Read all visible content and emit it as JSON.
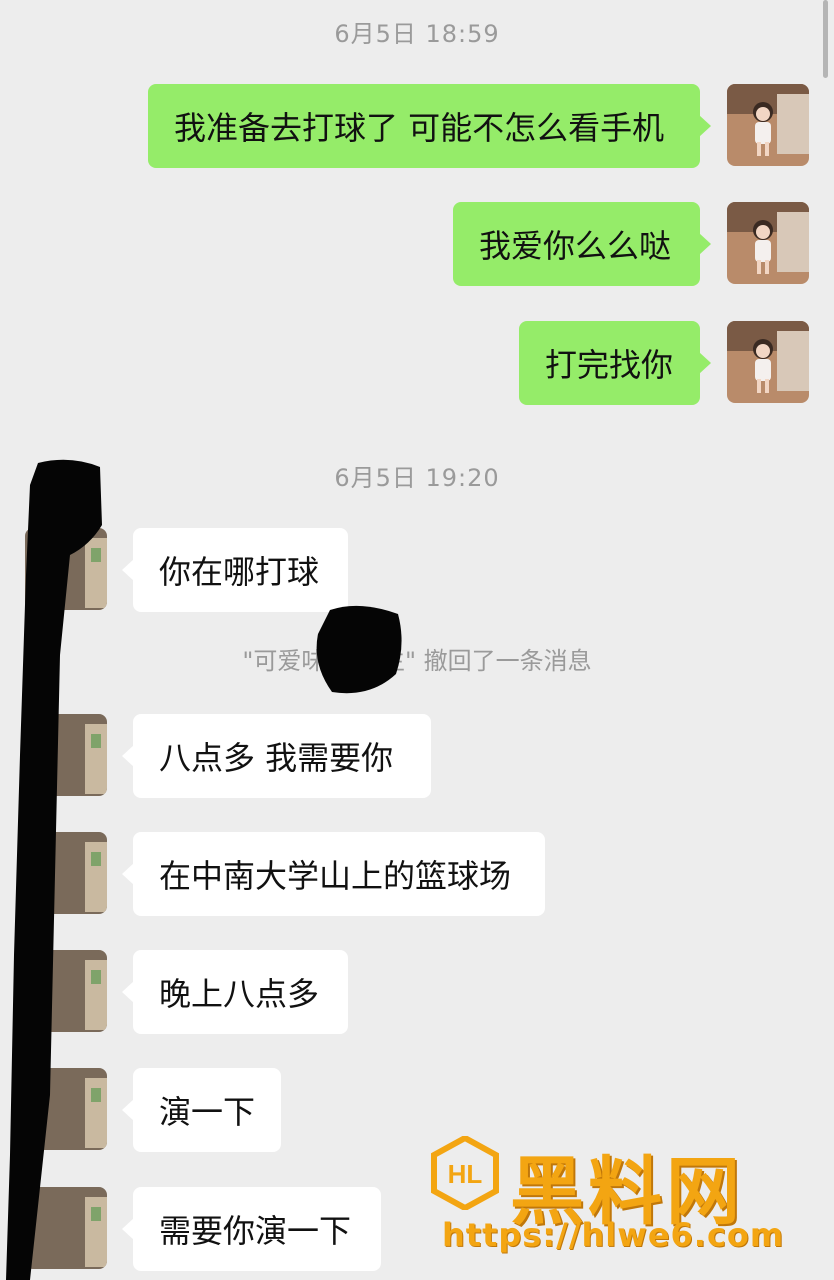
{
  "timestamps": [
    "6月5日 18:59",
    "6月5日 19:20"
  ],
  "outgoing_messages": [
    "我准备去打球了 可能不怎么看手机",
    "我爱你么么哒",
    "打完找你"
  ],
  "incoming_messages": [
    "你在哪打球",
    "八点多 我需要你",
    "在中南大学山上的篮球场",
    "晚上八点多",
    "演一下",
    "需要你演一下"
  ],
  "recall_notice": "\"可爱味的 先生\" 撤回了一条消息",
  "watermark": {
    "logo_text": "HL",
    "title": "黑料网",
    "url": "https://hlwe6.com"
  },
  "colors": {
    "background": "#ededed",
    "outgoing_bubble": "#95ec69",
    "incoming_bubble": "#ffffff",
    "watermark": "#f3a512"
  }
}
